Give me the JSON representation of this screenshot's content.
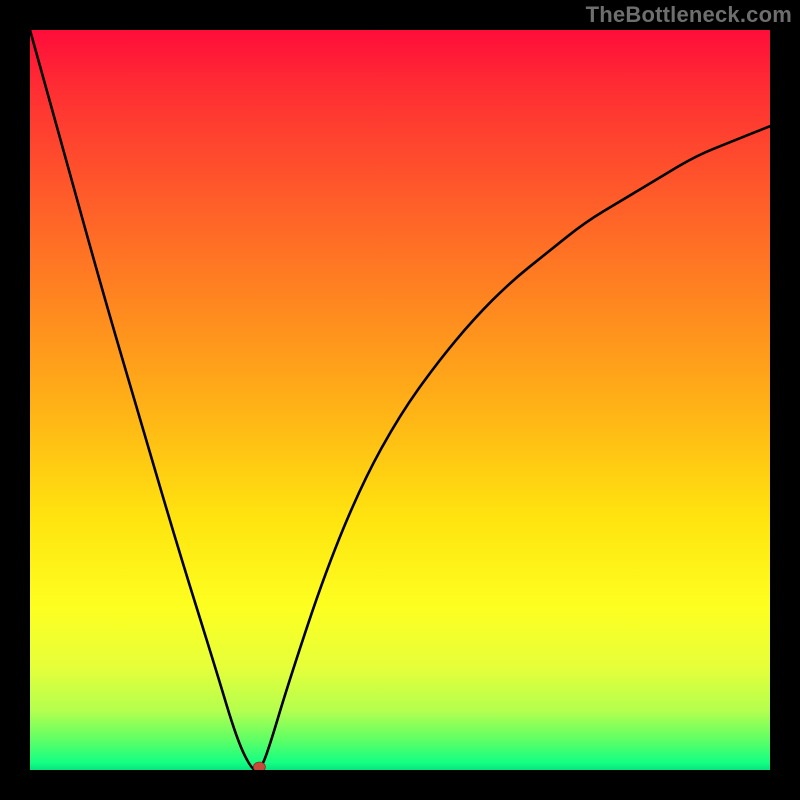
{
  "watermark": "TheBottleneck.com",
  "chart_data": {
    "type": "line",
    "title": "",
    "xlabel": "",
    "ylabel": "",
    "xlim": [
      0,
      100
    ],
    "ylim": [
      0,
      100
    ],
    "grid": false,
    "legend": false,
    "series": [
      {
        "name": "bottleneck-curve",
        "x": [
          0,
          5,
          10,
          15,
          20,
          25,
          28,
          30,
          31,
          32,
          35,
          40,
          45,
          50,
          55,
          60,
          65,
          70,
          75,
          80,
          85,
          90,
          95,
          100
        ],
        "values": [
          100,
          82,
          64,
          47,
          30,
          14,
          4,
          0,
          0,
          2,
          12,
          27,
          39,
          48,
          55,
          61,
          66,
          70,
          74,
          77,
          80,
          83,
          85,
          87
        ]
      }
    ],
    "annotations": [
      {
        "name": "optimal-point",
        "x": 31,
        "y": 0
      }
    ],
    "gradient_stops": [
      {
        "pct": 0,
        "color": "#ff0d3a"
      },
      {
        "pct": 22,
        "color": "#ff5a2a"
      },
      {
        "pct": 52,
        "color": "#ffb516"
      },
      {
        "pct": 78,
        "color": "#fdff20"
      },
      {
        "pct": 96,
        "color": "#5cff66"
      },
      {
        "pct": 100,
        "color": "#05e57e"
      }
    ]
  }
}
